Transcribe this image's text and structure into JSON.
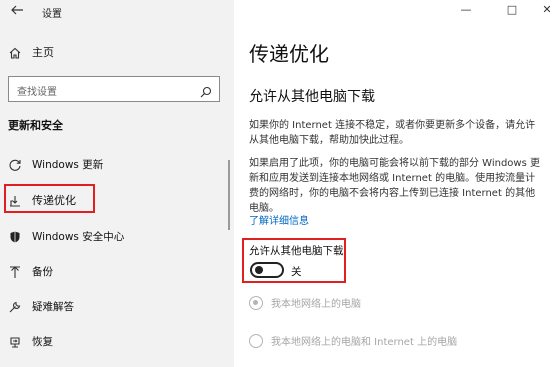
{
  "window": {
    "title": "设置",
    "back_icon": "back-arrow-icon",
    "controls": [
      "—",
      "□",
      "✕"
    ]
  },
  "sidebar": {
    "home_label": "主页",
    "search_placeholder": "查找设置",
    "section_title": "更新和安全",
    "items": [
      {
        "label": "Windows 更新",
        "icon": "refresh-icon"
      },
      {
        "label": "传递优化",
        "icon": "delivery-optimization-icon",
        "active": true
      },
      {
        "label": "Windows 安全中心",
        "icon": "shield-icon"
      },
      {
        "label": "备份",
        "icon": "backup-icon"
      },
      {
        "label": "疑难解答",
        "icon": "wrench-icon"
      },
      {
        "label": "恢复",
        "icon": "recovery-icon"
      }
    ]
  },
  "main": {
    "title": "传递优化",
    "subtitle": "允许从其他电脑下载",
    "para1": "如果你的 Internet 连接不稳定，或者你要更新多个设备，请允许从其他电脑下载，帮助加快此过程。",
    "para2": "如果启用了此项，你的电脑可能会将以前下载的部分 Windows 更新和应用发送到连接本地网络或 Internet 的电脑。使用按流量计费的网络时，你的电脑不会将内容上传到已连接 Internet 的其他电脑。",
    "learn_more": "了解详细信息",
    "toggle_label": "允许从其他电脑下载",
    "toggle_state": "关",
    "toggle_on": false,
    "radio1": "我本地网络上的电脑",
    "radio2": "我本地网络上的电脑和 Internet 上的电脑"
  },
  "colors": {
    "highlight_box": "#e02020",
    "link": "#0067c0",
    "disabled": "#a6a6a6",
    "sidebar_bg": "#f2f2f2"
  }
}
